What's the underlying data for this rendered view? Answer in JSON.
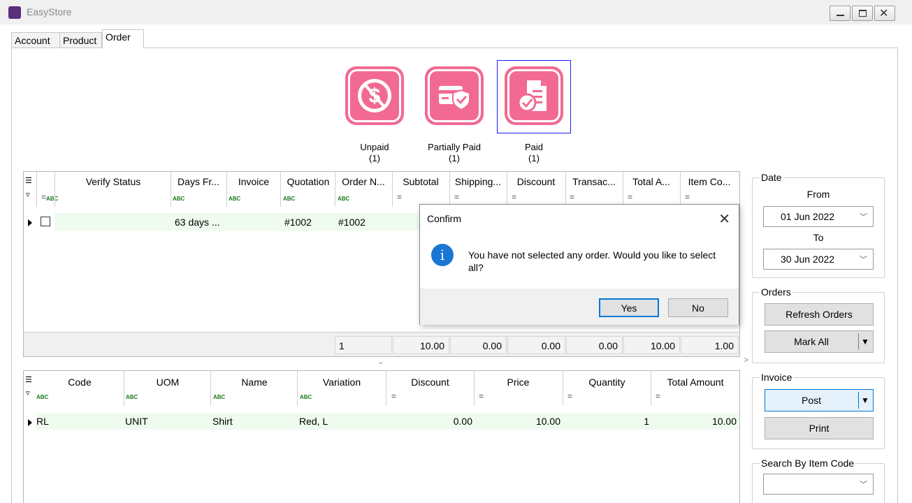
{
  "window": {
    "title": "EasyStore",
    "app_icon_text": "EASY STORE"
  },
  "tabs": [
    {
      "label": "Account"
    },
    {
      "label": "Product"
    },
    {
      "label": "Order"
    }
  ],
  "status_cards": [
    {
      "label": "Unpaid",
      "count": "(1)",
      "icon": "unpaid-dollar-icon"
    },
    {
      "label": "Partially Paid",
      "count": "(1)",
      "icon": "partial-payment-card-icon"
    },
    {
      "label": "Paid",
      "count": "(1)",
      "icon": "paid-invoice-icon"
    }
  ],
  "orders_grid": {
    "headers": [
      "Verify Status",
      "Days Fr...",
      "Invoice",
      "Quotation",
      "Order N...",
      "Subtotal",
      "Shipping...",
      "Discount",
      "Transac...",
      "Total A...",
      "Item Co..."
    ],
    "row": {
      "days": "63 days ...",
      "invoice": "",
      "quotation": "#1002",
      "order_no": "#1002"
    },
    "footer": [
      "1",
      "10.00",
      "0.00",
      "0.00",
      "0.00",
      "10.00",
      "1.00"
    ]
  },
  "items_grid": {
    "headers": [
      "Code",
      "UOM",
      "Name",
      "Variation",
      "Discount",
      "Price",
      "Quantity",
      "Total Amount"
    ],
    "row": {
      "code": "RL",
      "uom": "UNIT",
      "name": "Shirt",
      "variation": "Red, L",
      "discount": "0.00",
      "price": "10.00",
      "quantity": "1",
      "total": "10.00"
    }
  },
  "sidebar": {
    "date": {
      "title": "Date",
      "from_label": "From",
      "from_value": "01 Jun 2022",
      "to_label": "To",
      "to_value": "30 Jun 2022"
    },
    "orders": {
      "title": "Orders",
      "refresh_label": "Refresh Orders",
      "mark_all_label": "Mark All"
    },
    "invoice": {
      "title": "Invoice",
      "post_label": "Post",
      "print_label": "Print"
    },
    "search": {
      "title": "Search By Item Code",
      "value": ""
    }
  },
  "dialog": {
    "title": "Confirm",
    "message": "You have not selected any order. Would you like to select all?",
    "yes_label": "Yes",
    "no_label": "No"
  },
  "colors": {
    "accent_pink": "#f26a93",
    "row_green": "#eefbee",
    "focus_blue": "#0078d7"
  }
}
